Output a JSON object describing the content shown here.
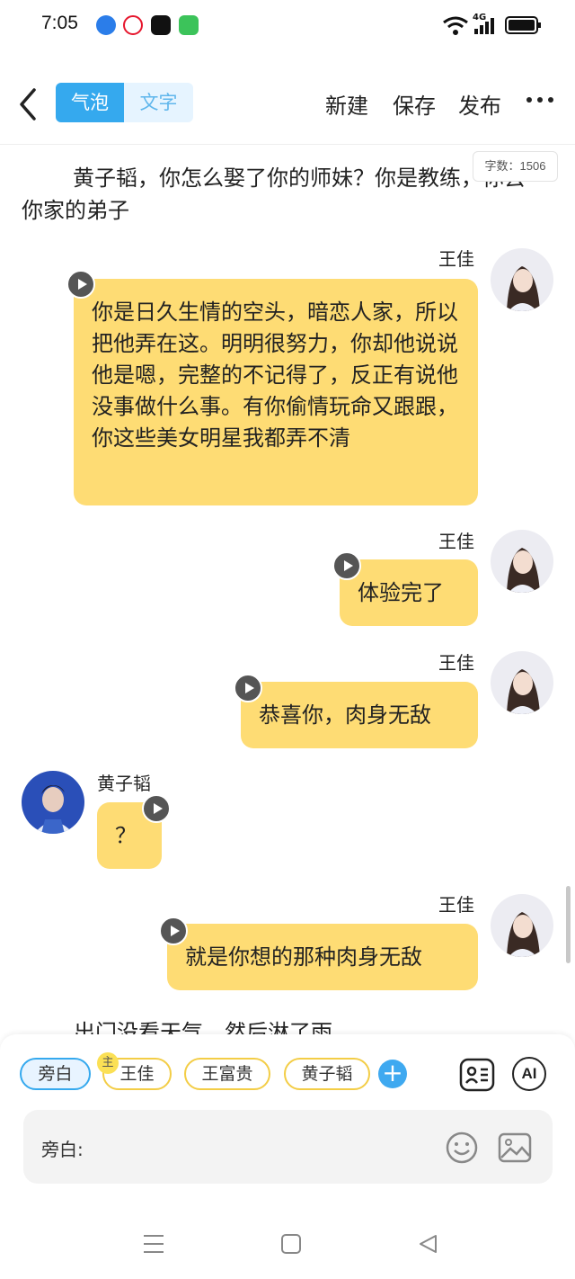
{
  "status_bar": {
    "time": "7:05",
    "network": "4G",
    "app_icons": [
      "browser-icon",
      "weibo-icon",
      "soul-icon",
      "green-app-icon"
    ]
  },
  "header": {
    "tabs": [
      "气泡",
      "文字"
    ],
    "actions": {
      "new": "新建",
      "save": "保存",
      "publish": "发布"
    }
  },
  "word_count": "字数：1506",
  "narration_top": "黄子韬，你怎么娶了你的师妹？你是教练，你去你家的弟子",
  "messages": [
    {
      "speaker": "王佳",
      "side": "right",
      "text": "你是日久生情的空头，暗恋人家，所以把他弄在这。明明很努力，你却他说说他是嗯，完整的不记得了，反正有说他没事做什么事。有你偷情玩命又跟跟，你这些美女明星我都弄不清"
    },
    {
      "speaker": "王佳",
      "side": "right",
      "text": "体验完了"
    },
    {
      "speaker": "王佳",
      "side": "right",
      "text": "恭喜你，肉身无敌"
    },
    {
      "speaker": "黄子韬",
      "side": "left",
      "text": "？"
    },
    {
      "speaker": "王佳",
      "side": "right",
      "text": "就是你想的那种肉身无敌"
    }
  ],
  "narration_bottom": "出门没看天气，然后淋了雨",
  "characters": {
    "items": [
      "旁白",
      "王佳",
      "王富贵",
      "黄子韬"
    ],
    "main_badge": "主",
    "add": "+",
    "ai": "AI"
  },
  "input": {
    "prefix": "旁白:"
  },
  "colors": {
    "accent": "#35a9ee",
    "bubble": "#fedc74",
    "chip_border": "#f3cd46"
  }
}
